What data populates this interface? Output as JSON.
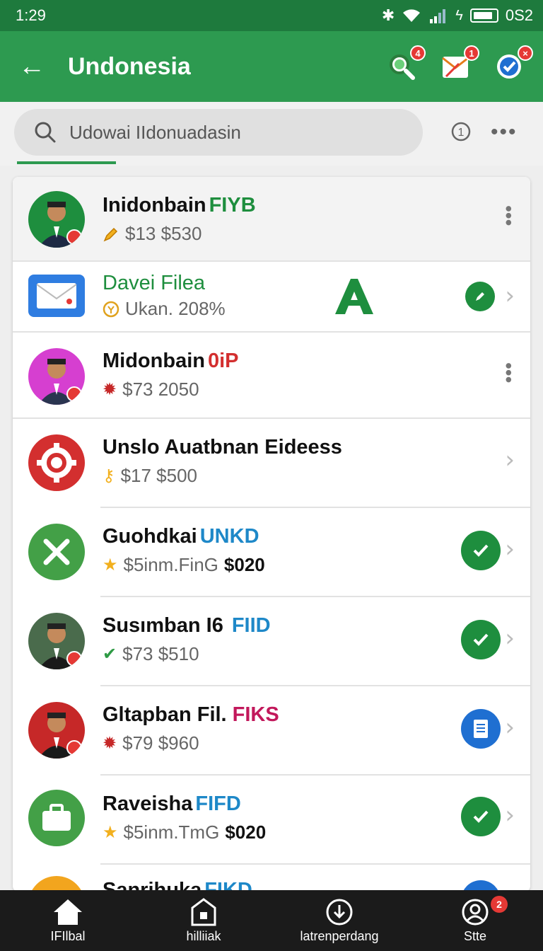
{
  "status_bar": {
    "time": "1:29",
    "right_text": "0S2"
  },
  "app_bar": {
    "title": "Undonesia",
    "search_badge": "4",
    "mail_badge": "1",
    "check_badge": "×"
  },
  "search": {
    "placeholder": "Udowai IIdonuadasin",
    "info_glyph": "1",
    "more_glyph": "•••"
  },
  "rows": [
    {
      "name": "Inidonbain",
      "tag": "FIYB",
      "tag_color": "#1e8e3e",
      "sub": "$13 $530",
      "sub_strong": ""
    },
    {
      "name": "Davei Filea",
      "tag": "",
      "tag_color": "#1e8e3e",
      "sub": "Ukan. 208%",
      "sub_strong": "",
      "logo_text": "A"
    },
    {
      "name": "Midonbain",
      "tag": "0iP",
      "tag_color": "#d32f2f",
      "sub": "$73 2050",
      "sub_strong": ""
    },
    {
      "name": "Unslo Auatbnan Eideess",
      "tag": "",
      "tag_color": "#111111",
      "sub": "$17 $500",
      "sub_strong": ""
    },
    {
      "name": "Guohdkai",
      "tag": "UNKD",
      "tag_color": "#1e88c8",
      "sub": "$5inm.FinG",
      "sub_strong": "$020"
    },
    {
      "name": "Susımban I6",
      "tag": "FIID",
      "tag_color": "#1e88c8",
      "sub": "$73 $510",
      "sub_strong": ""
    },
    {
      "name": "Gltapban Fil.",
      "tag": "FIKS",
      "tag_color": "#c2185b",
      "sub": "$79 $960",
      "sub_strong": ""
    },
    {
      "name": "Raveisha",
      "tag": "FIFD",
      "tag_color": "#1e88c8",
      "sub": "$5inm.TmG",
      "sub_strong": "$020"
    },
    {
      "name": "Sanrihuka",
      "tag": "FIKD",
      "tag_color": "#1e88c8",
      "sub": "",
      "sub_strong": ""
    }
  ],
  "bottom_nav": [
    {
      "label": "IFIlbal"
    },
    {
      "label": "hilliiak"
    },
    {
      "label": "latrenperdang"
    },
    {
      "label": "Stte",
      "badge": "2"
    }
  ]
}
